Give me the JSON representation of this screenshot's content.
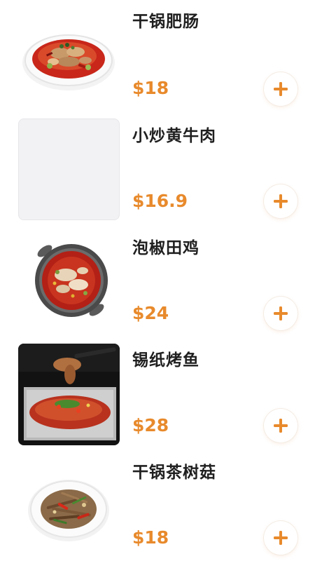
{
  "menu": {
    "items": [
      {
        "name": "干锅肥肠",
        "price": "$18",
        "image": "dry-pot-intestines-dish"
      },
      {
        "name": "小炒黄牛肉",
        "price": "$16.9",
        "image": "placeholder"
      },
      {
        "name": "泡椒田鸡",
        "price": "$24",
        "image": "pickled-pepper-frog-pot"
      },
      {
        "name": "锡纸烤鱼",
        "price": "$28",
        "image": "foil-grilled-fish"
      },
      {
        "name": "干锅茶树菇",
        "price": "$18",
        "image": "dry-pot-tea-tree-mushroom"
      }
    ],
    "add_icon": "plus-icon",
    "accent_color": "#e88a2c"
  }
}
